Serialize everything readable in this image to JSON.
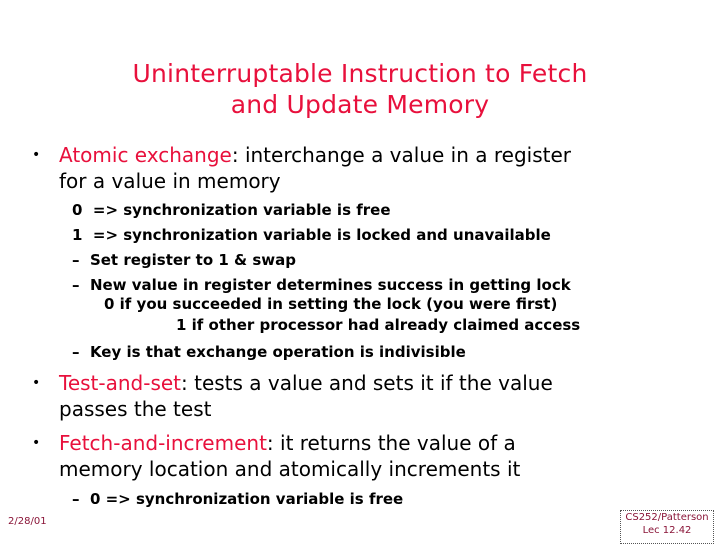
{
  "slide": {
    "title_line1": "Uninterruptable Instruction to Fetch",
    "title_line2": "and Update Memory",
    "bullets": [
      {
        "term": "Atomic exchange",
        "rest_line1": ": interchange a value in a register",
        "rest_line2": "for a value in memory",
        "subitems": [
          "0  => synchronization variable is free",
          "1  => synchronization variable is locked and unavailable",
          "–  Set register to 1 & swap",
          "–  New value in register determines success in getting lock",
          "0 if you succeeded in setting the lock (you were first)",
          "1 if other processor had already claimed access",
          "–  Key is that exchange operation is indivisible"
        ]
      },
      {
        "term": "Test-and-set",
        "rest_line1": ": tests a value and sets it if the value",
        "rest_line2": "passes the test"
      },
      {
        "term": "Fetch-and-increment",
        "rest_line1": ": it returns the value of a",
        "rest_line2": "memory location and atomically increments it",
        "subitems": [
          "–  0 => synchronization variable is free"
        ]
      }
    ],
    "bullet_glyph": "•"
  },
  "footer": {
    "date": "2/28/01",
    "course": "CS252/Patterson",
    "lecture": "Lec 12.42"
  }
}
